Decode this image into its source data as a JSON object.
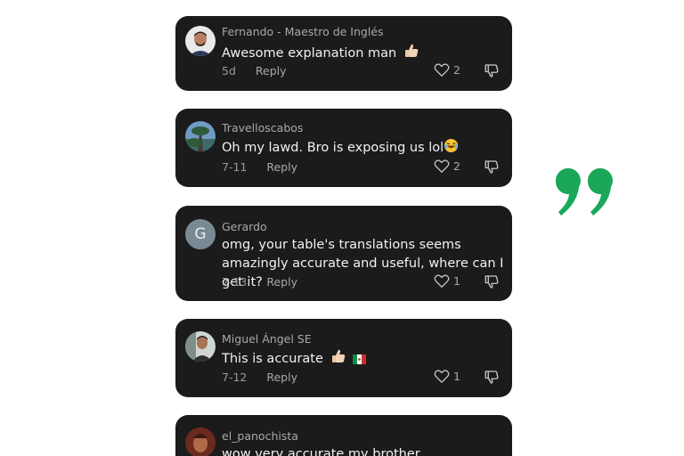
{
  "comments": [
    {
      "username": "Fernando - Maestro de Inglés",
      "text": "Awesome explanation man",
      "time": "5d",
      "reply_label": "Reply",
      "likes": "2",
      "avatar": "avatar-photo"
    },
    {
      "username": "Travelloscabos",
      "text": "Oh my lawd. Bro is exposing us lol",
      "time": "7-11",
      "reply_label": "Reply",
      "likes": "2",
      "avatar": "avatar-photo"
    },
    {
      "username": "Gerardo",
      "text": "omg, your table's translations seems amazingly accurate and useful, where can I get it?",
      "time": "7-13",
      "reply_label": "Reply",
      "likes": "1",
      "avatar": "avatar-letter",
      "avatar_letter": "G"
    },
    {
      "username": "Miguel Ángel SE",
      "text": "This is accurate",
      "time": "7-12",
      "reply_label": "Reply",
      "likes": "1",
      "avatar": "avatar-photo"
    },
    {
      "username": "el_panochista",
      "text": "wow very accurate my brother",
      "avatar": "avatar-photo"
    }
  ],
  "icons": {
    "like": "heart-outline-icon",
    "dislike": "thumbs-down-icon",
    "quote": "closing-quote-icon"
  },
  "colors": {
    "card_background": "#1b1b1b",
    "quote_accent": "#1aa75a"
  }
}
